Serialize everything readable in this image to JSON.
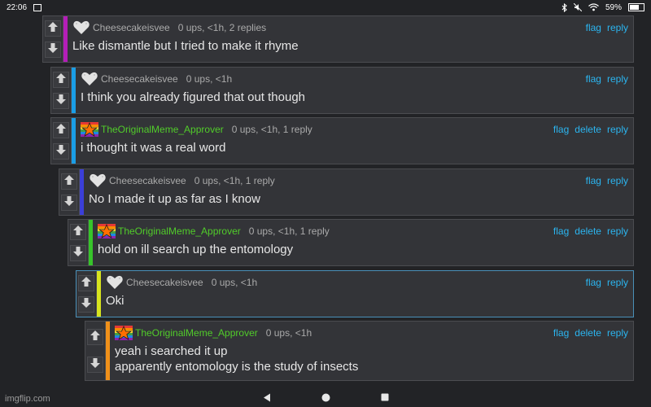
{
  "statusbar": {
    "time": "22:06",
    "battery": "59%",
    "battery_level": 0.59,
    "icons": [
      "image-icon",
      "bluetooth-icon",
      "mute-icon",
      "wifi-icon",
      "battery-icon"
    ]
  },
  "vote_icons": {
    "up": "arrow-up-icon",
    "down": "arrow-down-icon"
  },
  "colors": {
    "background": "#222326",
    "link": "#2bb5f0",
    "approver_name": "#51cc2a",
    "default_name": "#aaaaaa"
  },
  "comments": [
    {
      "user": "Cheesecakeisvee",
      "avatar": "heart-avatar",
      "stats": "0 ups, <1h, 2 replies",
      "actions": [
        "flag",
        "reply"
      ],
      "lines": [
        "Like dismantle but I tried to make it rhyme"
      ],
      "bar_color": "#b41eb8"
    },
    {
      "user": "Cheesecakeisvee",
      "avatar": "heart-avatar",
      "stats": "0 ups, <1h",
      "actions": [
        "flag",
        "reply"
      ],
      "lines": [
        "I think you already figured that out though"
      ],
      "bar_color": "#1a9ee6"
    },
    {
      "user": "TheOriginalMeme_Approver",
      "avatar": "star-avatar",
      "stats": "0 ups, <1h, 1 reply",
      "actions": [
        "flag",
        "delete",
        "reply"
      ],
      "lines": [
        "i thought it was a real word"
      ],
      "bar_color": "#1a9ee6"
    },
    {
      "user": "Cheesecakeisvee",
      "avatar": "heart-avatar",
      "stats": "0 ups, <1h, 1 reply",
      "actions": [
        "flag",
        "reply"
      ],
      "lines": [
        "No I made it up as far as I know"
      ],
      "bar_color": "#3b3fd8"
    },
    {
      "user": "TheOriginalMeme_Approver",
      "avatar": "star-avatar",
      "stats": "0 ups, <1h, 1 reply",
      "actions": [
        "flag",
        "delete",
        "reply"
      ],
      "lines": [
        "hold on ill search up the entomology"
      ],
      "bar_color": "#37c42a"
    },
    {
      "user": "Cheesecakeisvee",
      "avatar": "heart-avatar",
      "stats": "0 ups, <1h",
      "actions": [
        "flag",
        "reply"
      ],
      "lines": [
        "Oki"
      ],
      "bar_color": "#d8e41e",
      "highlighted": true
    },
    {
      "user": "TheOriginalMeme_Approver",
      "avatar": "star-avatar",
      "stats": "0 ups, <1h",
      "actions": [
        "flag",
        "delete",
        "reply"
      ],
      "lines": [
        "yeah i searched it up",
        "apparently entomology is the study of insects"
      ],
      "bar_color": "#f0901a"
    }
  ],
  "navbar": {
    "icons": [
      "back-icon",
      "home-icon",
      "recents-icon"
    ]
  },
  "watermark": "imgflip.com"
}
